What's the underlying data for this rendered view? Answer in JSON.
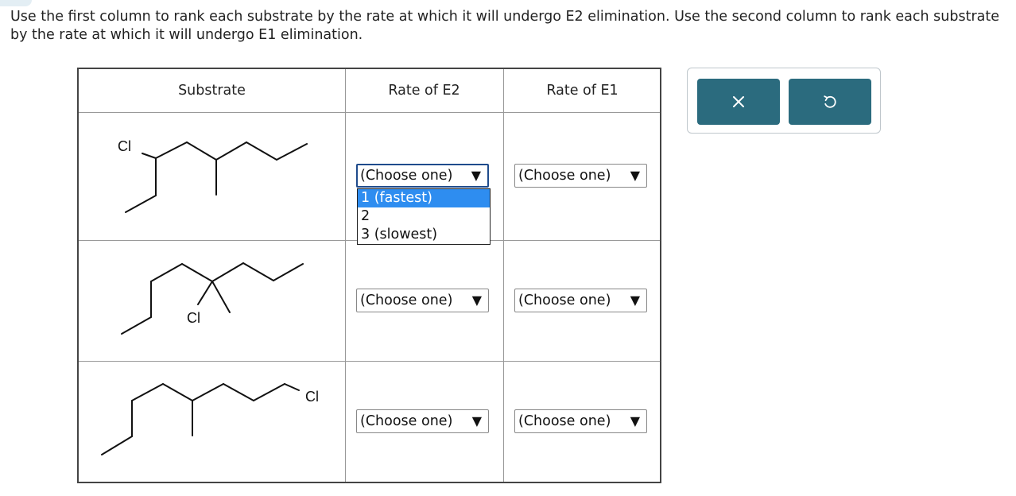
{
  "prompt": {
    "text": "Use the first column to rank each substrate by the rate at which it will undergo E2 elimination. Use the second column to rank each substrate by the rate at which it will undergo E1 elimination."
  },
  "table": {
    "headers": [
      "Substrate",
      "Rate of E2",
      "Rate of E1"
    ],
    "rows": [
      {
        "atom_label": "Cl",
        "e2_value": "(Choose one)",
        "e1_value": "(Choose one)"
      },
      {
        "atom_label": "Cl",
        "e2_value": "(Choose one)",
        "e1_value": "(Choose one)"
      },
      {
        "atom_label": "Cl",
        "e2_value": "(Choose one)",
        "e1_value": "(Choose one)"
      }
    ]
  },
  "open_dropdown": {
    "options": [
      "1 (fastest)",
      "2",
      "3 (slowest)"
    ],
    "highlighted": "1 (fastest)"
  },
  "icons": {
    "select_arrow": "▼",
    "close": "close-icon",
    "undo": "undo-icon"
  },
  "colors": {
    "button_bg": "#2b6b7e",
    "highlight": "#2e8df0",
    "focus_border": "#1f4b8c"
  }
}
